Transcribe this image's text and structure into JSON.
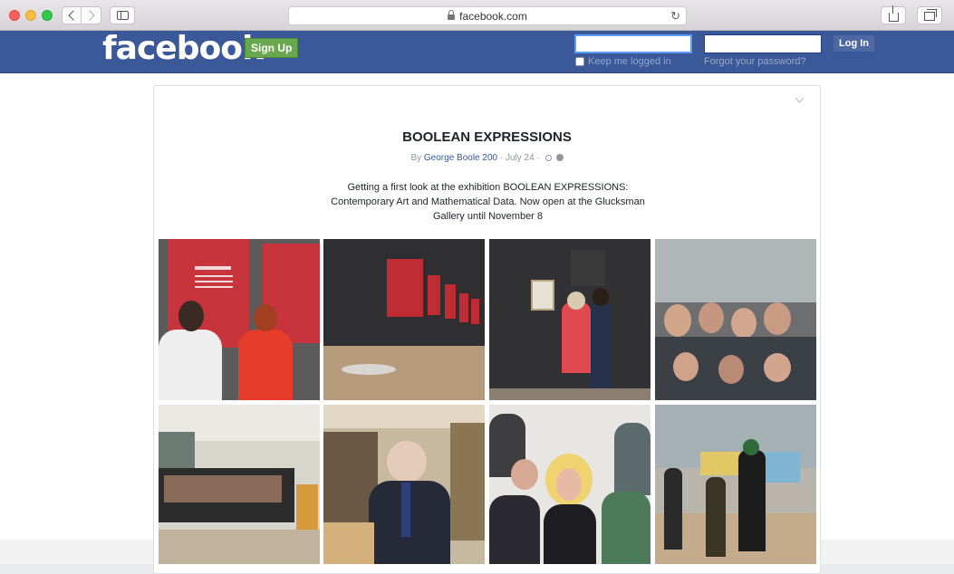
{
  "browser": {
    "url": "facebook.com",
    "back_icon": "chevron-left-icon",
    "forward_icon": "chevron-right-icon",
    "sidebar_icon": "sidebar-icon",
    "share_icon": "share-icon",
    "tabs_icon": "tabs-icon",
    "reload_glyph": "↻"
  },
  "header": {
    "logo": "facebook",
    "signup_label": "Sign Up",
    "login_label": "Log In",
    "keep_logged_in_label": "Keep me logged in",
    "forgot_password_label": "Forgot your password?",
    "email_value": "",
    "password_value": "",
    "brand_color": "#3b5998"
  },
  "post": {
    "title": "BOOLEAN EXPRESSIONS",
    "by_prefix": "By ",
    "author": "George Boole 200",
    "date": " · July 24 · ",
    "body": "Getting a first look at the exhibition BOOLEAN EXPRESSIONS: Contemporary Art and Mathematical Data. Now open at the Glucksman Gallery until November 8"
  }
}
